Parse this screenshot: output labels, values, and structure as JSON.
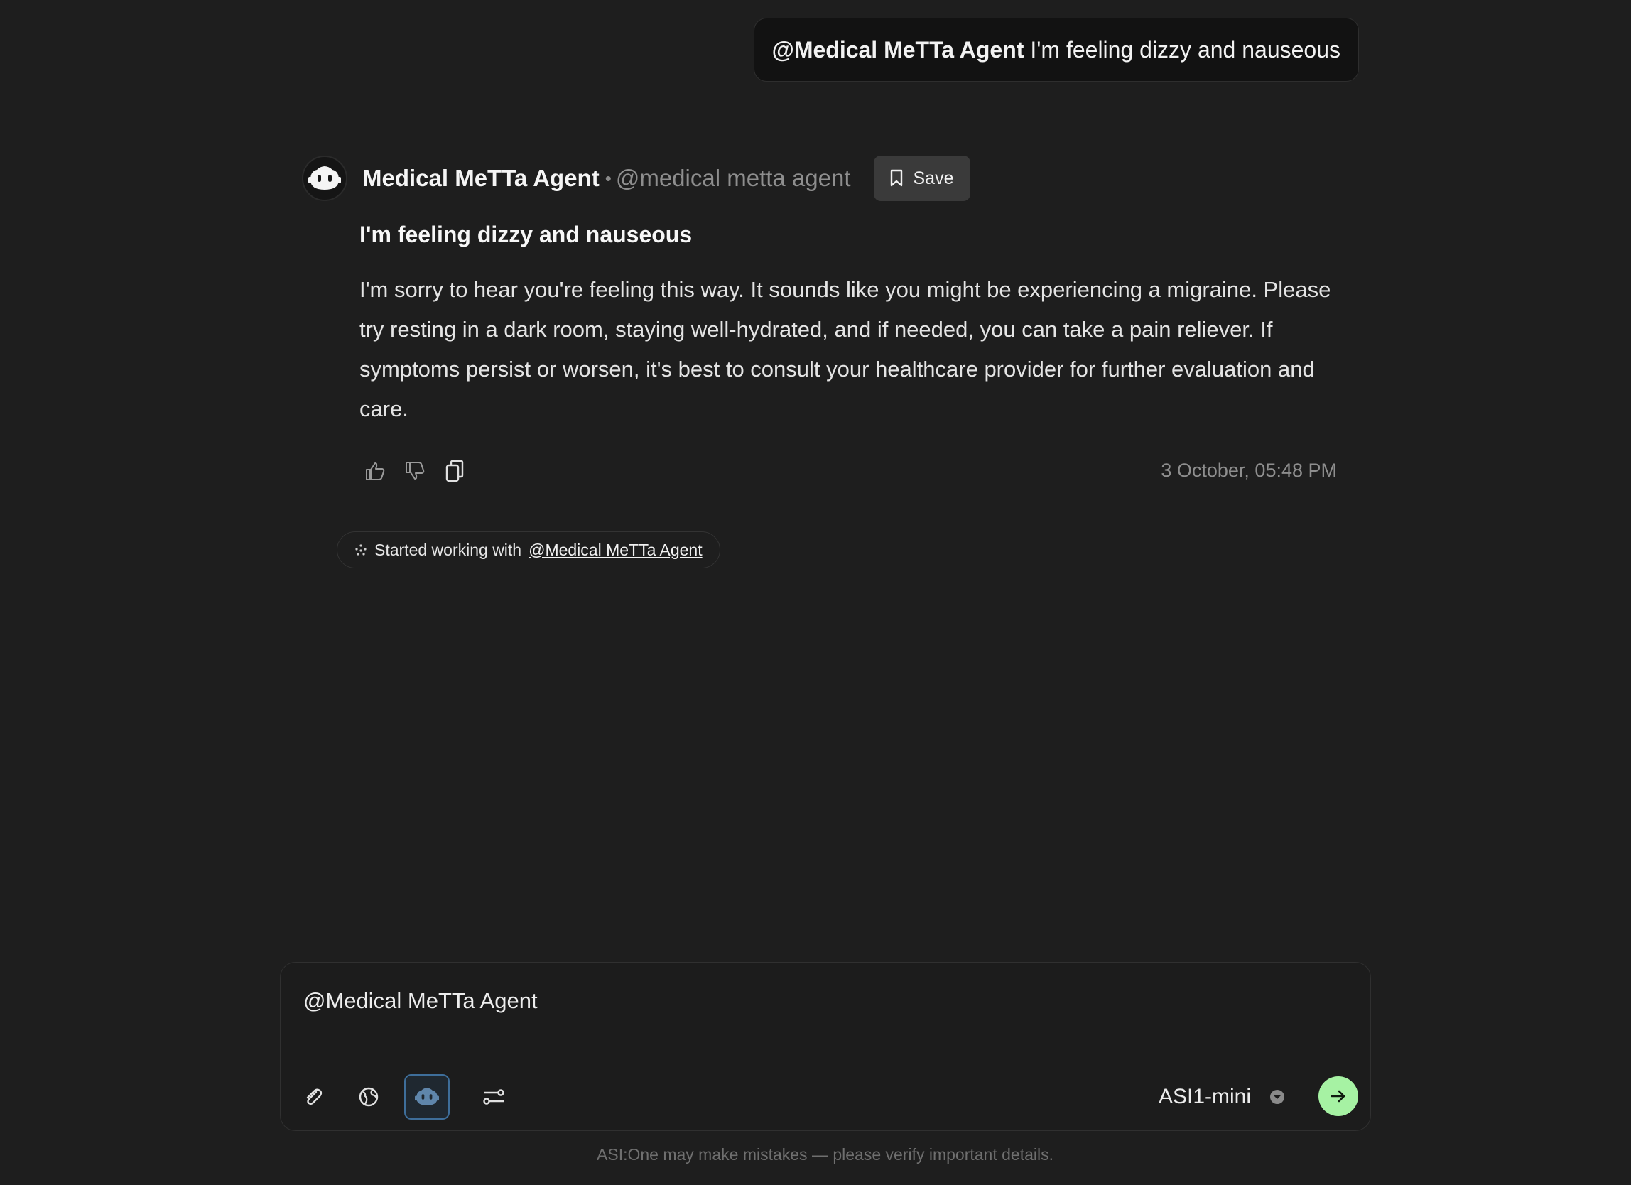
{
  "user_message": {
    "mention": "@Medical MeTTa Agent",
    "text": "I'm feeling dizzy and nauseous"
  },
  "agent": {
    "name": "Medical MeTTa Agent",
    "separator": "•",
    "handle": "@medical metta agent",
    "avatar_icon": "robot-icon",
    "save_label": "Save"
  },
  "answer": {
    "title": "I'm feeling dizzy and nauseous",
    "body": "I'm sorry to hear you're feeling this way. It sounds like you might be experiencing a migraine. Please try resting in a dark room, staying well-hydrated, and if needed, you can take a pain reliever. If symptoms persist or worsen, it's best to consult your healthcare provider for further evaluation and care.",
    "timestamp": "3 October, 05:48 PM",
    "actions": [
      "thumbs-up-icon",
      "thumbs-down-icon",
      "copy-icon"
    ]
  },
  "status": {
    "prefix": "Started working with",
    "agent_link": "@Medical MeTTa Agent"
  },
  "composer": {
    "value": "@Medical MeTTa Agent",
    "tools": [
      "paperclip-icon",
      "globe-icon",
      "agent-icon",
      "settings-sliders-icon"
    ],
    "model": "ASI1-mini"
  },
  "footer": {
    "disclaimer": "ASI:One may make mistakes — please verify important details."
  },
  "colors": {
    "background": "#1e1e1e",
    "send_button": "#a6f2a3",
    "active_tool_border": "#3e6e9a"
  }
}
